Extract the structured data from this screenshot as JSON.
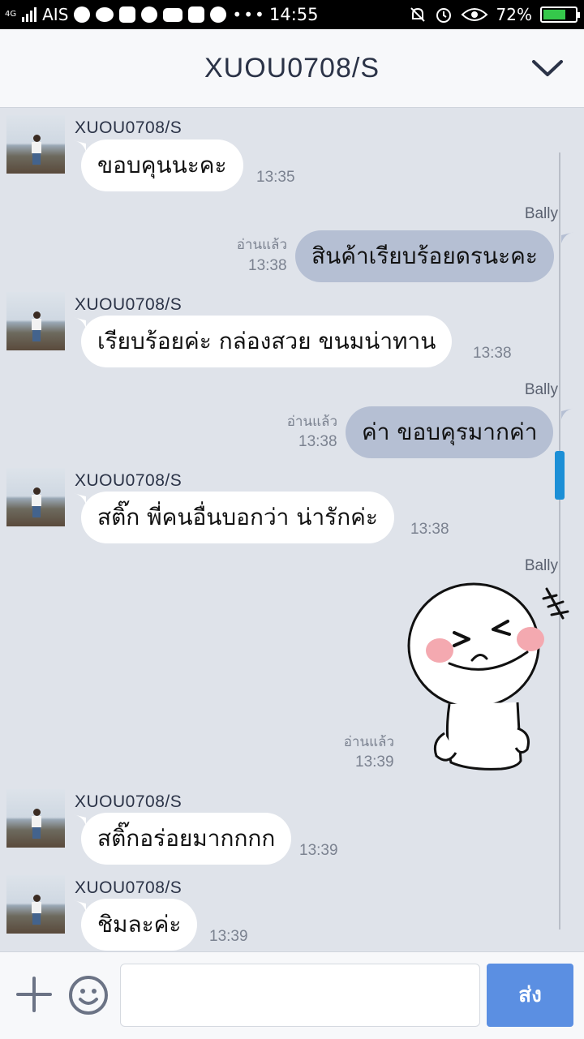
{
  "status_bar": {
    "carrier": "AIS",
    "network": "4G",
    "time": "14:55",
    "battery": "72%",
    "battery_level": 0.72
  },
  "header": {
    "title": "XUOU0708/S"
  },
  "messages": [
    {
      "sender": "XUOU0708/S",
      "text": "ขอบคุนนะคะ",
      "time": "13:35"
    },
    {
      "me_name": "Bally",
      "read_label": "อ่านแล้ว",
      "time": "13:38",
      "text": "สินค้าเรียบร้อยดรนะคะ"
    },
    {
      "sender": "XUOU0708/S",
      "text": "เรียบร้อยค่ะ กล่องสวย ขนมน่าทาน",
      "time": "13:38"
    },
    {
      "me_name": "Bally",
      "read_label": "อ่านแล้ว",
      "time": "13:38",
      "text": "ค่า  ขอบคุรมากค่า"
    },
    {
      "sender": "XUOU0708/S",
      "text": "สติ๊ก พี่คนอื่นบอกว่า น่ารักค่ะ",
      "time": "13:38"
    },
    {
      "me_name": "Bally",
      "read_label": "อ่านแล้ว",
      "time": "13:39",
      "sticker": "laughing-face-sticker"
    },
    {
      "sender": "XUOU0708/S",
      "text": "สติ๊กอร่อยมากกกก",
      "time": "13:39"
    },
    {
      "sender": "XUOU0708/S",
      "text": "ชิมละค่ะ",
      "time": "13:39"
    }
  ],
  "input": {
    "placeholder": "",
    "send_label": "ส่ง"
  },
  "colors": {
    "incoming_bubble": "#ffffff",
    "outgoing_bubble": "#b5bfd3",
    "chat_background": "#dfe3ea",
    "send_button": "#5b8fe2",
    "scrollbar": "#1c8fd6"
  },
  "icons": [
    "signal-icon",
    "chrome-icon",
    "twitter-icon",
    "instagram-icon",
    "line-icon",
    "youtube-icon",
    "at-icon",
    "pinterest-icon",
    "more-icon",
    "mute-icon",
    "alarm-icon",
    "eye-icon",
    "battery-icon",
    "chevron-down-icon",
    "plus-icon",
    "emoji-icon"
  ]
}
